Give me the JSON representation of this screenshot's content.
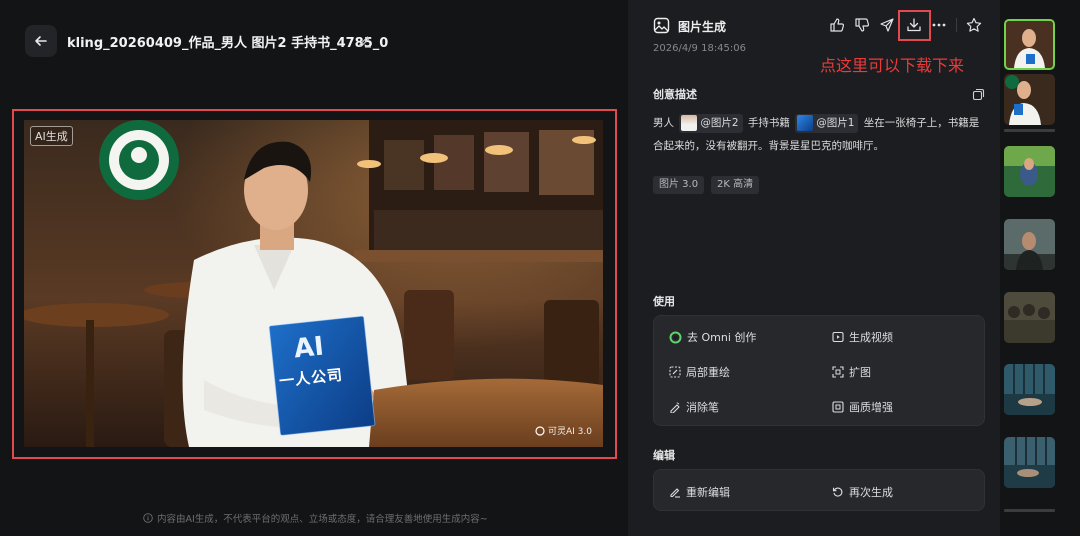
{
  "header": {
    "title": "kling_20260409_作品_男人 图片2 手持书_4785_0"
  },
  "image": {
    "ai_tag": "AI生成",
    "watermark": "可灵AI 3.0",
    "book_big": "AI",
    "book_title": "一人公司"
  },
  "footer": {
    "note": "内容由AI生成，不代表平台的观点、立场或态度，请合理友善地使用生成内容~"
  },
  "panel": {
    "title": "图片生成",
    "timestamp": "2026/4/9 18:45:06",
    "annotation": "点这里可以下载下来",
    "description_label": "创意描述",
    "desc": {
      "t1": "男人",
      "ref1": "@图片2",
      "t2": "手持书籍",
      "ref2": "@图片1",
      "t3": "坐在一张椅子上，书籍是合起来的，没有被翻开。背景是星巴克的咖啡厅。"
    },
    "chips": [
      "图片 3.0",
      "2K 高清"
    ],
    "use_label": "使用",
    "use_actions": {
      "omni": "去 Omni 创作",
      "video": "生成视频",
      "inpaint": "局部重绘",
      "expand": "扩图",
      "erase": "消除笔",
      "enhance": "画质增强"
    },
    "edit_label": "编辑",
    "edit_actions": {
      "reedit": "重新编辑",
      "regen": "再次生成"
    }
  },
  "colors": {
    "highlight_red": "#e24a4f",
    "annotation_red": "#ea3b3b",
    "selected_green": "#72d24a"
  }
}
